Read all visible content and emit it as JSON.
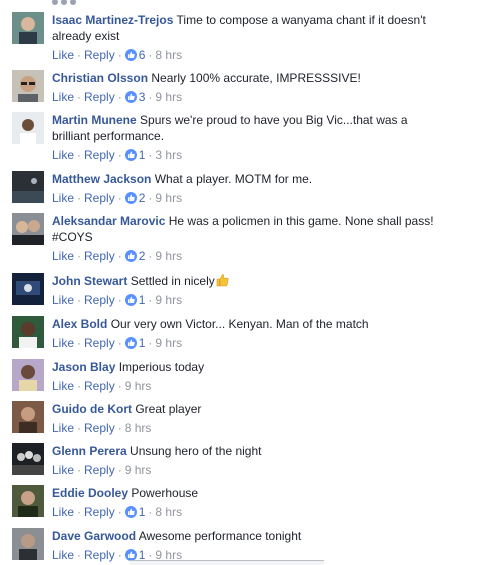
{
  "comments": [
    {
      "name": "Isaac Martinez-Trejos",
      "text": "Time to compose a wanyama chant if it doesn't already exist",
      "likes": "6",
      "time": "8 hrs",
      "avatar": "avatar-teal"
    },
    {
      "name": "Christian Olsson",
      "text": "Nearly 100% accurate, IMPRESSSIVE!",
      "likes": "3",
      "time": "9 hrs",
      "avatar": "avatar-glasses"
    },
    {
      "name": "Martin Munene",
      "text": "Spurs we're proud to have you Big Vic...that was a brilliant performance.",
      "likes": "1",
      "time": "3 hrs",
      "avatar": "avatar-light"
    },
    {
      "name": "Matthew Jackson",
      "text": "What a player. MOTM for me.",
      "likes": "2",
      "time": "9 hrs",
      "avatar": "avatar-dark"
    },
    {
      "name": "Aleksandar Marovic",
      "text": "He was a policmen in this game. None shall pass! #COYS",
      "likes": "2",
      "time": "9 hrs",
      "avatar": "avatar-two"
    },
    {
      "name": "John Stewart",
      "text": "Settled in nicely",
      "emoji": "thumbs-up-emoji",
      "likes": "1",
      "time": "9 hrs",
      "avatar": "avatar-navy"
    },
    {
      "name": "Alex Bold",
      "text": "Our very own Victor... Kenyan. Man of the match",
      "likes": "1",
      "time": "9 hrs",
      "avatar": "avatar-green"
    },
    {
      "name": "Jason Blay",
      "text": "Imperious today",
      "likes": "",
      "time": "9 hrs",
      "avatar": "avatar-purple"
    },
    {
      "name": "Guido de Kort",
      "text": "Great player",
      "likes": "",
      "time": "8 hrs",
      "avatar": "avatar-brown"
    },
    {
      "name": "Glenn Perera",
      "text": "Unsung hero of the night",
      "likes": "",
      "time": "9 hrs",
      "avatar": "avatar-group"
    },
    {
      "name": "Eddie Dooley",
      "text": "Powerhouse",
      "likes": "1",
      "time": "8 hrs",
      "avatar": "avatar-olive"
    },
    {
      "name": "Dave Garwood",
      "text": "Awesome performance tonight",
      "likes": "1",
      "time": "9 hrs",
      "avatar": "avatar-grey"
    }
  ],
  "labels": {
    "like": "Like",
    "reply": "Reply",
    "separator": "·"
  },
  "colors": {
    "link": "#4267b2",
    "name": "#365899",
    "like_badge": "#5890ff",
    "meta": "#90949c"
  }
}
